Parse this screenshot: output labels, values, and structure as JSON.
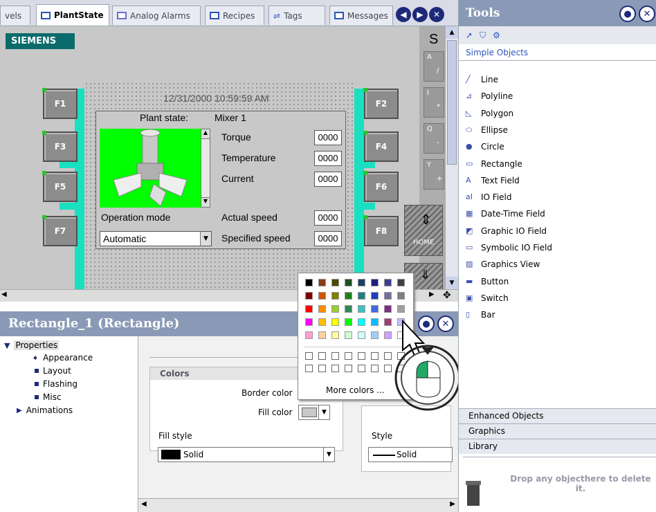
{
  "tabs": [
    "vels",
    "PlantState",
    "Analog Alarms",
    "Recipes",
    "Tags",
    "Messages"
  ],
  "brand": "SIEMENS",
  "screen": {
    "datetime": "12/31/2000 10:59:59 AM",
    "plant_state_label": "Plant state:",
    "plant_state_value": "Mixer 1",
    "labels": [
      "Torque",
      "Temperature",
      "Current",
      "Actual speed",
      "Specified speed"
    ],
    "values": [
      "0000",
      "0000",
      "0000",
      "0000",
      "0000"
    ],
    "operation_mode_label": "Operation mode",
    "operation_mode_value": "Automatic",
    "fkeys": [
      "F1",
      "F2",
      "F3",
      "F4",
      "F5",
      "F6",
      "F7",
      "F8"
    ],
    "side_letters": [
      "S",
      "A",
      "I",
      "Q",
      "Y"
    ],
    "side_symbols": [
      "/",
      "*",
      "-",
      "+"
    ],
    "home_label": "HOME"
  },
  "properties": {
    "title": "Rectangle_1 (Rectangle)",
    "tree": [
      "Properties",
      "Appearance",
      "Layout",
      "Flashing",
      "Misc",
      "Animations"
    ],
    "colors_group": "Colors",
    "border_color_label": "Border color",
    "fill_color_label": "Fill color",
    "fill_style_label": "Fill style",
    "fill_style_value": "Solid",
    "style_label": "Style",
    "style_value": "Solid",
    "more_colors": "More colors ..."
  },
  "palette": [
    [
      "#000000",
      "#8b3a1a",
      "#4a4a00",
      "#1f4f1f",
      "#1f3f5f",
      "#1f1f7f",
      "#3f3f8f",
      "#3f3f3f"
    ],
    [
      "#7f0000",
      "#d35400",
      "#7f7f00",
      "#1f7f1f",
      "#1f7f7f",
      "#1f3fbf",
      "#6f6f9f",
      "#7f7f7f"
    ],
    [
      "#ff0000",
      "#ff8c00",
      "#9acd32",
      "#2e8b57",
      "#40c0c0",
      "#4169e1",
      "#7f2f7f",
      "#9f9f9f"
    ],
    [
      "#ff00ff",
      "#ffc000",
      "#ffff00",
      "#00ff00",
      "#00ffff",
      "#00bfff",
      "#9f3f6f",
      "#c0c0ff"
    ],
    [
      "#ff9fcf",
      "#ffcf9f",
      "#ffff9f",
      "#cfffcf",
      "#cfffff",
      "#9fcfff",
      "#cf9fff",
      "#ffffff"
    ]
  ],
  "tools": {
    "title": "Tools",
    "section": "Simple Objects",
    "items": [
      "Line",
      "Polyline",
      "Polygon",
      "Ellipse",
      "Circle",
      "Rectangle",
      "Text Field",
      "IO Field",
      "Date-Time Field",
      "Graphic IO Field",
      "Symbolic IO Field",
      "Graphics View",
      "Button",
      "Switch",
      "Bar"
    ],
    "sections": [
      "Enhanced Objects",
      "Graphics",
      "Library"
    ],
    "drop_hint": "Drop any objecthere to delete it."
  },
  "colors": {
    "accent": "#8a9ab6",
    "cyan": "#19e0c0",
    "green": "#00ff00",
    "brand": "#0b6b6b"
  }
}
